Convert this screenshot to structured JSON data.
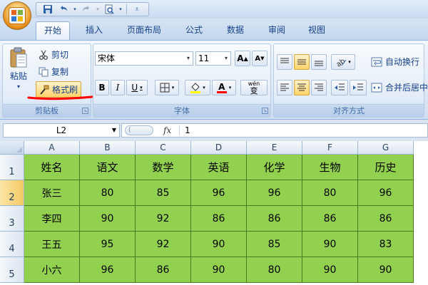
{
  "quick_access": {
    "icons": [
      "save-icon",
      "undo-icon",
      "redo-icon",
      "print-preview-icon",
      "customize-icon"
    ]
  },
  "tabs": [
    {
      "label": "开始",
      "active": true
    },
    {
      "label": "插入"
    },
    {
      "label": "页面布局"
    },
    {
      "label": "公式"
    },
    {
      "label": "数据"
    },
    {
      "label": "审阅"
    },
    {
      "label": "视图"
    }
  ],
  "ribbon": {
    "clipboard": {
      "paste_label": "粘贴",
      "cut_label": "剪切",
      "copy_label": "复制",
      "format_painter_label": "格式刷",
      "group_label": "剪贴板"
    },
    "font": {
      "font_name": "宋体",
      "font_size": "11",
      "grow_label": "A",
      "shrink_label": "A",
      "bold_label": "B",
      "italic_label": "I",
      "underline_label": "U",
      "font_color_label": "A",
      "phonetic_label": "wén",
      "phonetic_char": "变",
      "group_label": "字体",
      "fill_color": "#ffff00",
      "font_color": "#ff0000"
    },
    "alignment": {
      "wrap_text_label": "自动换行",
      "merge_center_label": "合并后居中",
      "group_label": "对齐方式"
    }
  },
  "formula_bar": {
    "name_box": "L2",
    "fx_label": "fx",
    "value": "1"
  },
  "sheet": {
    "columns": [
      "A",
      "B",
      "C",
      "D",
      "E",
      "F",
      "G"
    ],
    "rows": [
      {
        "num": "1",
        "cells": [
          "姓名",
          "语文",
          "数学",
          "英语",
          "化学",
          "生物",
          "历史"
        ]
      },
      {
        "num": "2",
        "cells": [
          "张三",
          "80",
          "85",
          "96",
          "96",
          "80",
          "96"
        ]
      },
      {
        "num": "3",
        "cells": [
          "李四",
          "90",
          "92",
          "86",
          "86",
          "86",
          "86"
        ]
      },
      {
        "num": "4",
        "cells": [
          "王五",
          "95",
          "92",
          "90",
          "85",
          "90",
          "83"
        ]
      },
      {
        "num": "5",
        "cells": [
          "小六",
          "96",
          "86",
          "90",
          "80",
          "90",
          "90"
        ]
      }
    ],
    "selected_row": "2",
    "fill_color": "#92d050"
  },
  "annotation_color": "#ff0000"
}
